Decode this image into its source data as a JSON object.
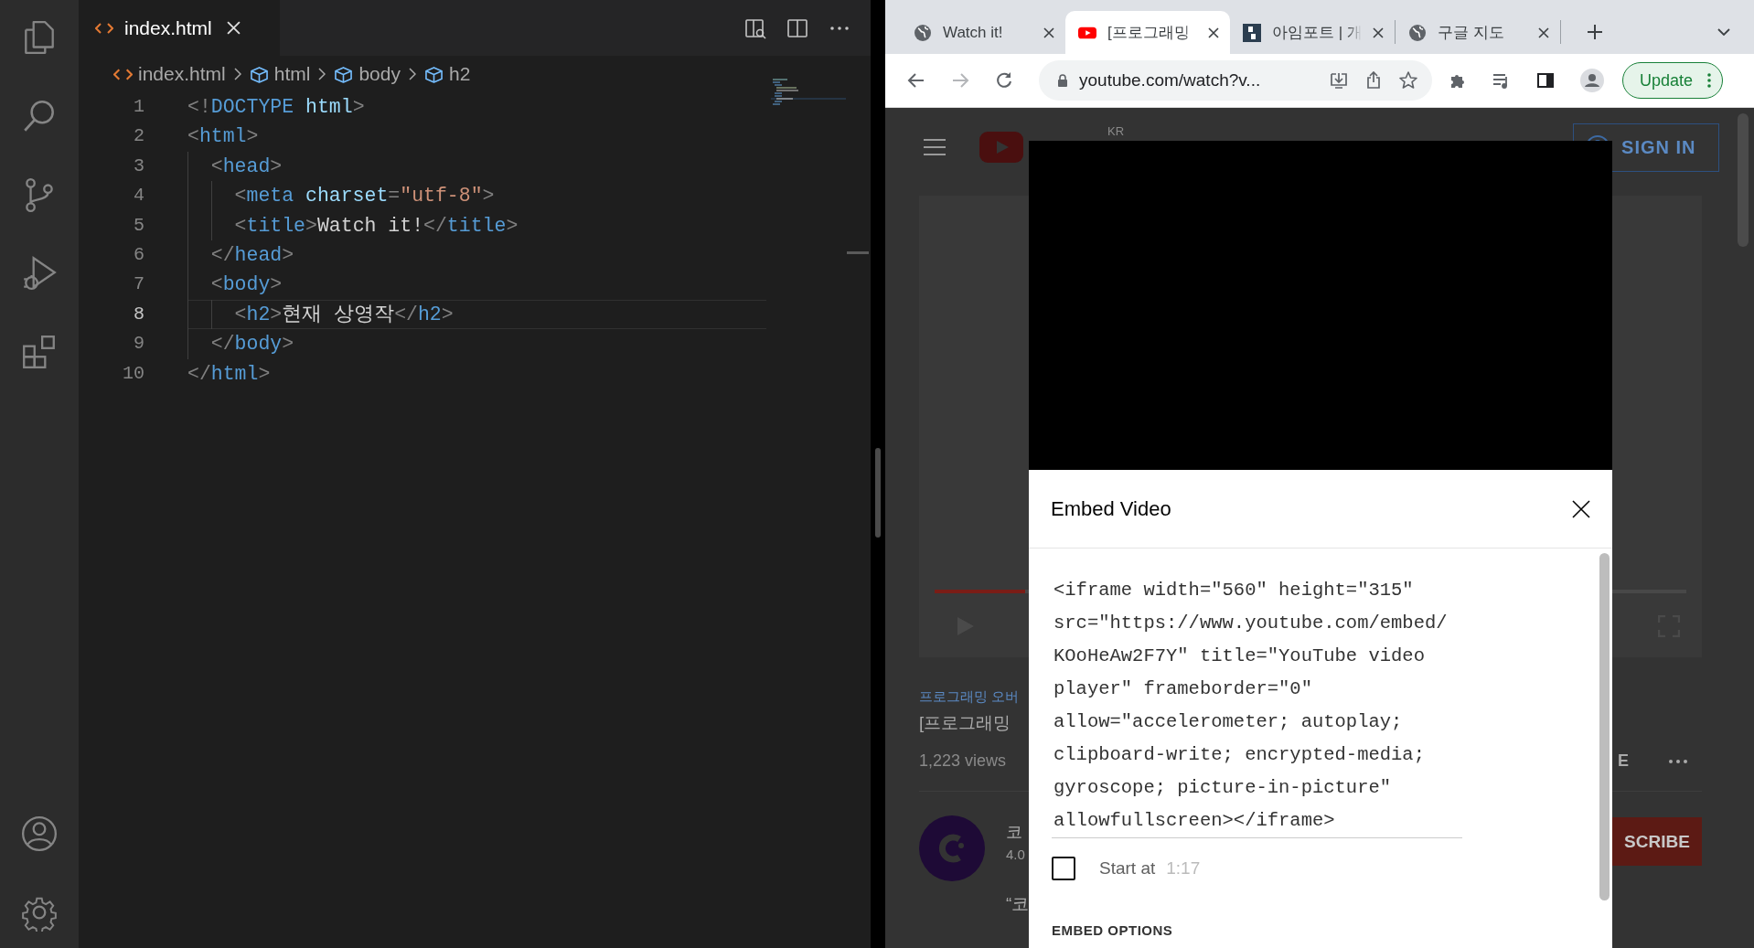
{
  "editor": {
    "tab": {
      "label": "index.html",
      "selected": true
    },
    "breadcrumb": [
      {
        "label": "index.html",
        "kind": "file"
      },
      {
        "label": "html",
        "kind": "element"
      },
      {
        "label": "body",
        "kind": "element"
      },
      {
        "label": "h2",
        "kind": "element"
      }
    ],
    "lines": [
      {
        "number": "1",
        "current": false,
        "tokens": [
          {
            "kind": "punct",
            "text": "<!"
          },
          {
            "kind": "tag",
            "text": "DOCTYPE "
          },
          {
            "kind": "attr",
            "text": "html"
          },
          {
            "kind": "punct",
            "text": ">"
          }
        ]
      },
      {
        "number": "2",
        "current": false,
        "tokens": [
          {
            "kind": "punct",
            "text": "<"
          },
          {
            "kind": "tag",
            "text": "html"
          },
          {
            "kind": "punct",
            "text": ">"
          }
        ]
      },
      {
        "number": "3",
        "current": false,
        "tokens": [
          {
            "kind": "punct",
            "text": "  <"
          },
          {
            "kind": "tag",
            "text": "head"
          },
          {
            "kind": "punct",
            "text": ">"
          }
        ]
      },
      {
        "number": "4",
        "current": false,
        "tokens": [
          {
            "kind": "punct",
            "text": "    <"
          },
          {
            "kind": "tag",
            "text": "meta "
          },
          {
            "kind": "attr",
            "text": "charset"
          },
          {
            "kind": "punct",
            "text": "="
          },
          {
            "kind": "string",
            "text": "\"utf-8\""
          },
          {
            "kind": "punct",
            "text": ">"
          }
        ]
      },
      {
        "number": "5",
        "current": false,
        "tokens": [
          {
            "kind": "punct",
            "text": "    <"
          },
          {
            "kind": "tag",
            "text": "title"
          },
          {
            "kind": "punct",
            "text": ">"
          },
          {
            "kind": "text",
            "text": "Watch it!"
          },
          {
            "kind": "punct",
            "text": "</"
          },
          {
            "kind": "tag",
            "text": "title"
          },
          {
            "kind": "punct",
            "text": ">"
          }
        ]
      },
      {
        "number": "6",
        "current": false,
        "tokens": [
          {
            "kind": "punct",
            "text": "  </"
          },
          {
            "kind": "tag",
            "text": "head"
          },
          {
            "kind": "punct",
            "text": ">"
          }
        ]
      },
      {
        "number": "7",
        "current": false,
        "tokens": [
          {
            "kind": "punct",
            "text": "  <"
          },
          {
            "kind": "tag",
            "text": "body"
          },
          {
            "kind": "punct",
            "text": ">"
          }
        ]
      },
      {
        "number": "8",
        "current": true,
        "tokens": [
          {
            "kind": "punct",
            "text": "    <"
          },
          {
            "kind": "tag",
            "text": "h2"
          },
          {
            "kind": "punct",
            "text": ">"
          },
          {
            "kind": "text",
            "text": "현재 상영작"
          },
          {
            "kind": "punct",
            "text": "</"
          },
          {
            "kind": "tag",
            "text": "h2"
          },
          {
            "kind": "punct",
            "text": ">"
          }
        ]
      },
      {
        "number": "9",
        "current": false,
        "tokens": [
          {
            "kind": "punct",
            "text": "  </"
          },
          {
            "kind": "tag",
            "text": "body"
          },
          {
            "kind": "punct",
            "text": ">"
          }
        ]
      },
      {
        "number": "10",
        "current": false,
        "tokens": [
          {
            "kind": "punct",
            "text": "</"
          },
          {
            "kind": "tag",
            "text": "html"
          },
          {
            "kind": "punct",
            "text": ">"
          }
        ]
      }
    ]
  },
  "browser": {
    "tabs": [
      {
        "title": "Watch it!",
        "kind": "globe",
        "selected": false
      },
      {
        "title": "[프로그래밍",
        "kind": "video",
        "selected": true
      },
      {
        "title": "아임포트 | 개",
        "kind": "logo",
        "selected": false
      },
      {
        "title": "구글 지도",
        "kind": "globe",
        "selected": false
      }
    ],
    "address": "youtube.com/watch?v...",
    "update_button": "Update"
  },
  "page": {
    "progress": {
      "level": 0.12
    },
    "country": "KR",
    "sign_in": "SIGN IN",
    "channel_label": "프로그래밍 오버",
    "video_title": "[프로그래밍",
    "views": "1,223 views",
    "action_fragment": "E",
    "channel_name": "코",
    "subscribers": "4.0",
    "subscribe_fragment": "SCRIBE",
    "description": "“코"
  },
  "modal": {
    "title": "Embed Video",
    "code_lines": [
      "<iframe width=\"560\" height=\"315\"",
      "src=\"https://www.youtube.com/embed/",
      "KOoHeAw2F7Y\" title=\"YouTube video",
      "player\" frameborder=\"0\"",
      "allow=\"accelerometer; autoplay;",
      "clipboard-write; encrypted-media;",
      "gyroscope; picture-in-picture\"",
      "allowfullscreen></iframe>"
    ],
    "start_at": {
      "label": "Start at",
      "time": "1:17",
      "checked": false
    },
    "section_heading": "EMBED OPTIONS"
  }
}
